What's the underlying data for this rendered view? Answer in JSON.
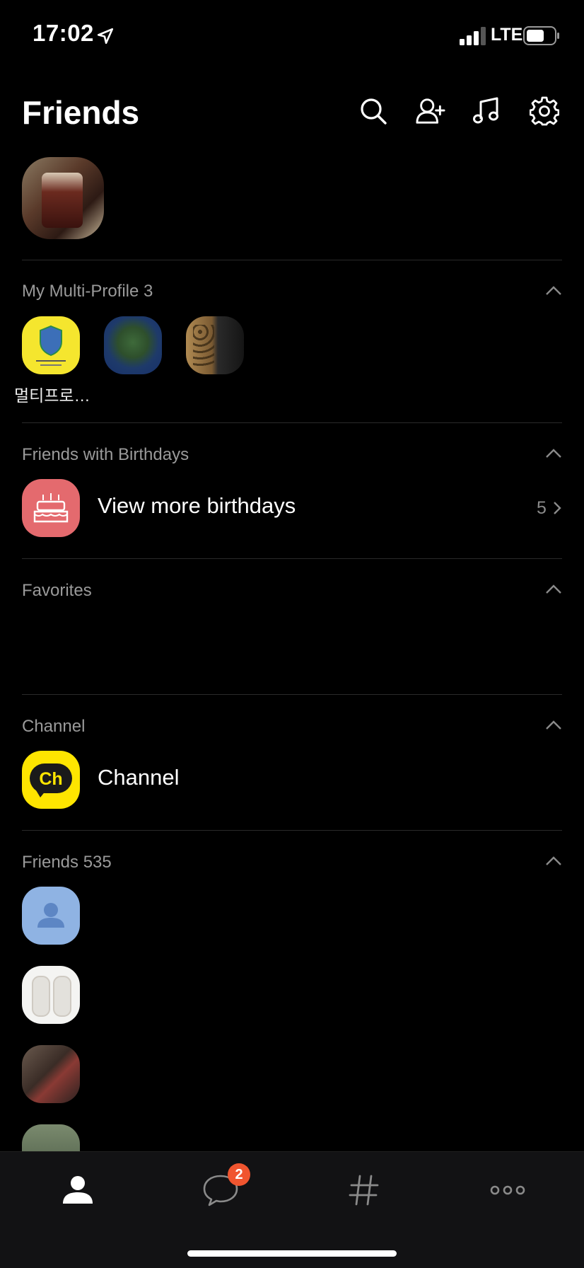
{
  "status_bar": {
    "time": "17:02",
    "network": "LTE"
  },
  "header": {
    "title": "Friends"
  },
  "sections": {
    "multi_profile": {
      "title": "My Multi-Profile 3",
      "first_label": "멀티프로…"
    },
    "birthdays": {
      "title": "Friends with Birthdays",
      "row_label": "View more birthdays",
      "count": "5"
    },
    "favorites": {
      "title": "Favorites"
    },
    "channel": {
      "title": "Channel",
      "row_label": "Channel",
      "icon_text": "Ch"
    },
    "friends": {
      "title": "Friends 535"
    }
  },
  "tabbar": {
    "chat_badge": "2"
  },
  "colors": {
    "background": "#000000",
    "badge": "#f0552f",
    "channel_yellow": "#fee500",
    "birthday_red": "#e46a6e"
  },
  "icons": [
    "location-arrow-icon",
    "signal-icon",
    "battery-icon",
    "search-icon",
    "add-friend-icon",
    "music-icon",
    "settings-icon",
    "chevron-up-icon",
    "chevron-right-icon",
    "cake-icon",
    "person-icon",
    "chat-bubble-icon",
    "hashtag-icon",
    "more-icon"
  ]
}
